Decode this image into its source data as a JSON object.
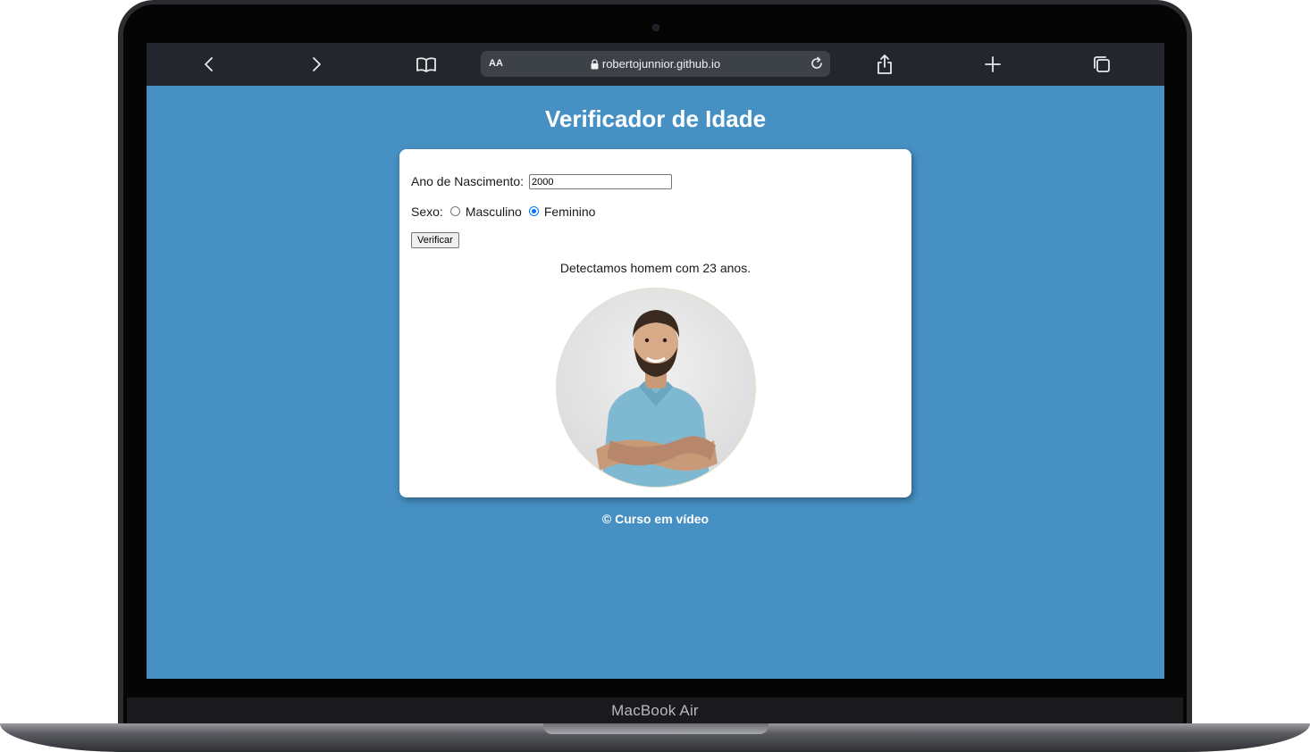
{
  "device": {
    "label": "MacBook Air"
  },
  "browser": {
    "text_size_label": "AA",
    "url": "robertojunnior.github.io",
    "icons": [
      "back-icon",
      "forward-icon",
      "bookmarks-icon",
      "lock-icon",
      "reload-icon",
      "share-icon",
      "new-tab-icon",
      "tabs-icon"
    ]
  },
  "page": {
    "title": "Verificador de Idade",
    "form": {
      "birth_year_label": "Ano de Nascimento:",
      "birth_year_value": "2000",
      "sex_label": "Sexo:",
      "sex_options": [
        {
          "label": "Masculino",
          "checked": false
        },
        {
          "label": "Feminino",
          "checked": true
        }
      ],
      "submit_label": "Verificar"
    },
    "result_text": "Detectamos homem com 23 anos.",
    "footer": "© Curso em vídeo"
  },
  "colors": {
    "page_background": "#4690c4",
    "card_background": "#ffffff",
    "browser_bar": "#23272d",
    "accent_radio": "#0075ff"
  }
}
